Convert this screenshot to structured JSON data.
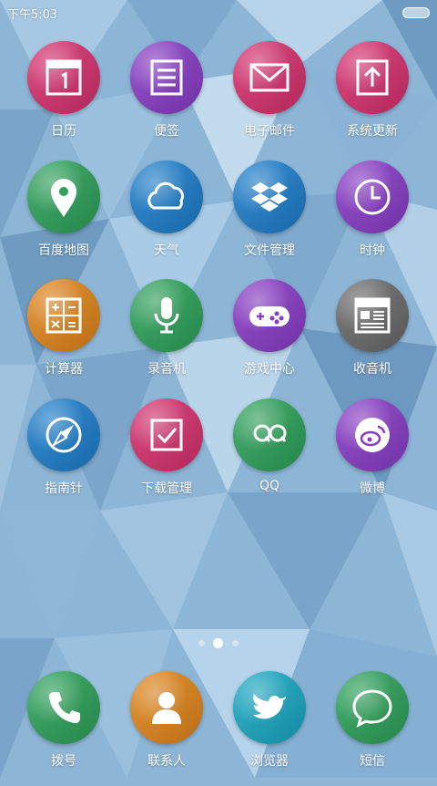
{
  "status_bar": {
    "time": "下午5:03"
  },
  "apps": [
    {
      "label": "日历",
      "icon": "calendar-icon",
      "color": "#d8316f"
    },
    {
      "label": "便签",
      "icon": "notes-icon",
      "color": "#8a3cc9"
    },
    {
      "label": "电子邮件",
      "icon": "mail-icon",
      "color": "#d8316f"
    },
    {
      "label": "系统更新",
      "icon": "update-icon",
      "color": "#d8316f"
    },
    {
      "label": "百度地图",
      "icon": "map-pin-icon",
      "color": "#2da35a"
    },
    {
      "label": "天气",
      "icon": "cloud-icon",
      "color": "#1c7fce"
    },
    {
      "label": "文件管理",
      "icon": "dropbox-icon",
      "color": "#1c7fce"
    },
    {
      "label": "时钟",
      "icon": "clock-icon",
      "color": "#8a3cc9"
    },
    {
      "label": "计算器",
      "icon": "calculator-icon",
      "color": "#e2861a"
    },
    {
      "label": "录音机",
      "icon": "microphone-icon",
      "color": "#2da35a"
    },
    {
      "label": "游戏中心",
      "icon": "gamepad-icon",
      "color": "#8a3cc9"
    },
    {
      "label": "收音机",
      "icon": "news-icon",
      "color": "#6b6b6b"
    },
    {
      "label": "指南针",
      "icon": "compass-icon",
      "color": "#1c7fce"
    },
    {
      "label": "下载管理",
      "icon": "checkbox-icon",
      "color": "#d8316f"
    },
    {
      "label": "QQ",
      "icon": "qq-icon",
      "color": "#2da35a"
    },
    {
      "label": "微博",
      "icon": "weibo-icon",
      "color": "#8a3cc9"
    }
  ],
  "dock": [
    {
      "label": "拨号",
      "icon": "phone-icon",
      "color": "#2da35a"
    },
    {
      "label": "联系人",
      "icon": "contact-icon",
      "color": "#e2861a"
    },
    {
      "label": "浏览器",
      "icon": "twitter-bird-icon",
      "color": "#18a9c4"
    },
    {
      "label": "短信",
      "icon": "message-bubble-icon",
      "color": "#2da35a"
    }
  ],
  "page_indicator": {
    "total": 3,
    "current": 2
  }
}
